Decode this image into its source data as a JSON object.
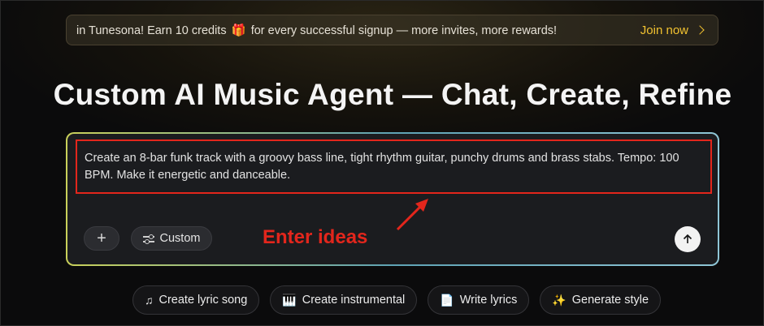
{
  "banner": {
    "text_before": "in Tunesona! Earn 10 credits",
    "gift_icon": "🎁",
    "text_after": "for every successful signup — more invites, more rewards!",
    "join_label": "Join now",
    "join_color": "#f2c230"
  },
  "title": "Custom AI Music Agent — Chat, Create, Refine",
  "prompt": {
    "text": "Create an 8-bar funk track with a groovy bass line, tight rhythm guitar, punchy drums and brass stabs. Tempo: 100 BPM. Make it energetic and danceable.",
    "plus_label": "+",
    "custom_label": "Custom",
    "annotation": "Enter ideas",
    "annotation_color": "#e3261c"
  },
  "chips": [
    {
      "icon": "♫",
      "icon_name": "music-note-icon",
      "label": "Create lyric song"
    },
    {
      "icon": "🎹",
      "icon_name": "piano-icon",
      "label": "Create instrumental"
    },
    {
      "icon": "📄",
      "icon_name": "document-icon",
      "label": "Write lyrics"
    },
    {
      "icon": "✨",
      "icon_name": "sparkles-icon",
      "label": "Generate style"
    }
  ]
}
